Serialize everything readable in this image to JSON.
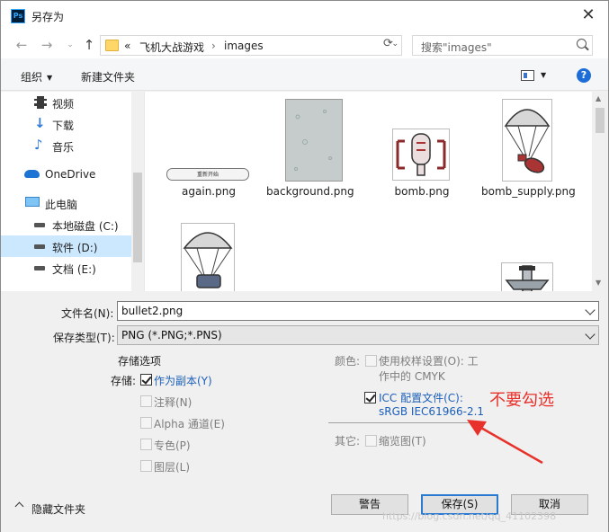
{
  "window": {
    "title": "另存为",
    "app_icon": "Ps"
  },
  "nav": {
    "breadcrumb": [
      "«",
      "飞机大战游戏",
      "›",
      "images"
    ],
    "search_placeholder": "搜索\"images\""
  },
  "toolbar": {
    "organize": "组织",
    "new_folder": "新建文件夹"
  },
  "sidebar": {
    "items": [
      {
        "label": "视频",
        "icon": "video-icon"
      },
      {
        "label": "下载",
        "icon": "download-icon"
      },
      {
        "label": "音乐",
        "icon": "music-icon"
      },
      {
        "label": "OneDrive",
        "icon": "cloud-icon"
      },
      {
        "label": "此电脑",
        "icon": "computer-icon"
      },
      {
        "label": "本地磁盘 (C:)",
        "icon": "drive-icon"
      },
      {
        "label": "软件 (D:)",
        "icon": "drive-icon",
        "selected": true
      },
      {
        "label": "文档 (E:)",
        "icon": "drive-icon"
      }
    ]
  },
  "files": [
    {
      "name": "again.png",
      "thumb_text": "重新开始"
    },
    {
      "name": "background.png"
    },
    {
      "name": "bomb.png"
    },
    {
      "name": "bomb_supply.png"
    }
  ],
  "form": {
    "filename_label": "文件名(N):",
    "filename_value": "bullet2.png",
    "filetype_label": "保存类型(T):",
    "filetype_value": "PNG (*.PNG;*.PNS)",
    "storage_title": "存储选项",
    "storage_label": "存储:",
    "as_copy": "作为副本(Y)",
    "notes": "注释(N)",
    "alpha": "Alpha 通道(E)",
    "spot": "专色(P)",
    "layers": "图层(L)",
    "color_label": "颜色:",
    "proof_line1": "使用校样设置(O):  工",
    "proof_line2": "作中的 CMYK",
    "icc_line1": "ICC 配置文件(C):",
    "icc_line2": "sRGB IEC61966-2.1",
    "other_label": "其它:",
    "thumbnail": "缩览图(T)"
  },
  "buttons": {
    "hide_folders": "隐藏文件夹",
    "warning": "警告",
    "save": "保存(S)",
    "cancel": "取消"
  },
  "annotation": {
    "text": "不要勾选",
    "color": "#e8312a"
  },
  "watermark": "https://blog.csdn.net/qq_41102398"
}
